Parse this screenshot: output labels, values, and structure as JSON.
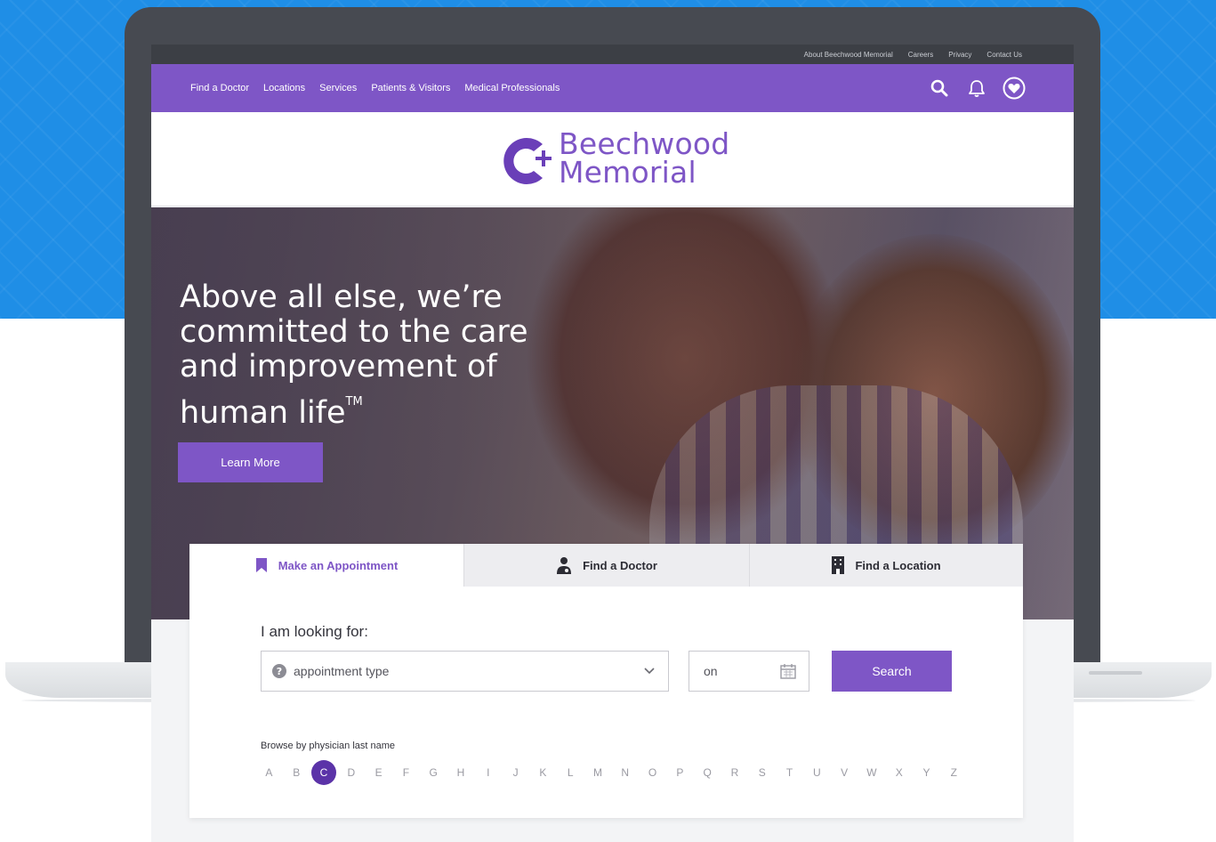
{
  "utility_nav": {
    "items": [
      "About Beechwood Memorial",
      "Careers",
      "Privacy",
      "Contact Us"
    ]
  },
  "main_nav": {
    "items": [
      "Find a Doctor",
      "Locations",
      "Services",
      "Patients & Visitors",
      "Medical Professionals"
    ]
  },
  "icons": {
    "search": "search-icon",
    "notifications": "bell-icon",
    "favorites": "heart-icon"
  },
  "logo": {
    "line1": "Beechwood",
    "line2": "Memorial"
  },
  "hero": {
    "heading": "Above all else, we’re committed to the care and improvement  of human life",
    "trademark": "TM",
    "cta": "Learn More"
  },
  "tabs": {
    "items": [
      "Make an Appointment",
      "Find a Doctor",
      "Find a Location"
    ],
    "active": "Make an Appointment"
  },
  "search": {
    "label": "I am looking for:",
    "appointment_placeholder": "appointment type",
    "date_placeholder": "on",
    "button": "Search"
  },
  "browse": {
    "label": "Browse by physician last name",
    "letters": [
      "A",
      "B",
      "C",
      "D",
      "E",
      "F",
      "G",
      "H",
      "I",
      "J",
      "K",
      "L",
      "M",
      "N",
      "O",
      "P",
      "Q",
      "R",
      "S",
      "T",
      "U",
      "V",
      "W",
      "X",
      "Y",
      "Z"
    ],
    "selected": "C"
  },
  "colors": {
    "brand_purple": "#7e56c6",
    "selected_letter": "#5b33a8",
    "utility_bar": "#3c3f45",
    "backdrop_blue": "#1f8ee6"
  }
}
